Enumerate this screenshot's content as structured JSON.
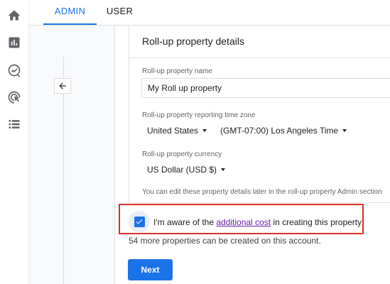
{
  "nav": {
    "icons": [
      "home-icon",
      "reports-icon",
      "explore-icon",
      "advertising-icon",
      "configure-icon"
    ]
  },
  "tabs": [
    {
      "label": "ADMIN"
    },
    {
      "label": "USER"
    }
  ],
  "panel": {
    "title": "Roll-up property details",
    "name_label": "Roll-up property name",
    "name_value": "My Roll up property",
    "tz_label": "Roll-up property reporting time zone",
    "country": "United States",
    "timezone": "(GMT-07:00) Los Angeles Time",
    "currency_label": "Roll-up property currency",
    "currency": "US Dollar (USD $)",
    "hint": "You can edit these property details later in the roll-up property Admin section"
  },
  "consent": {
    "prefix": "I'm aware of the ",
    "link": "additional cost",
    "suffix": " in creating this property",
    "checked": true
  },
  "footer": {
    "remaining": "54 more properties can be created on this account.",
    "next_label": "Next"
  },
  "colors": {
    "accent": "#1a73e8",
    "highlight_box": "#d93025",
    "link_visited": "#681da8"
  }
}
